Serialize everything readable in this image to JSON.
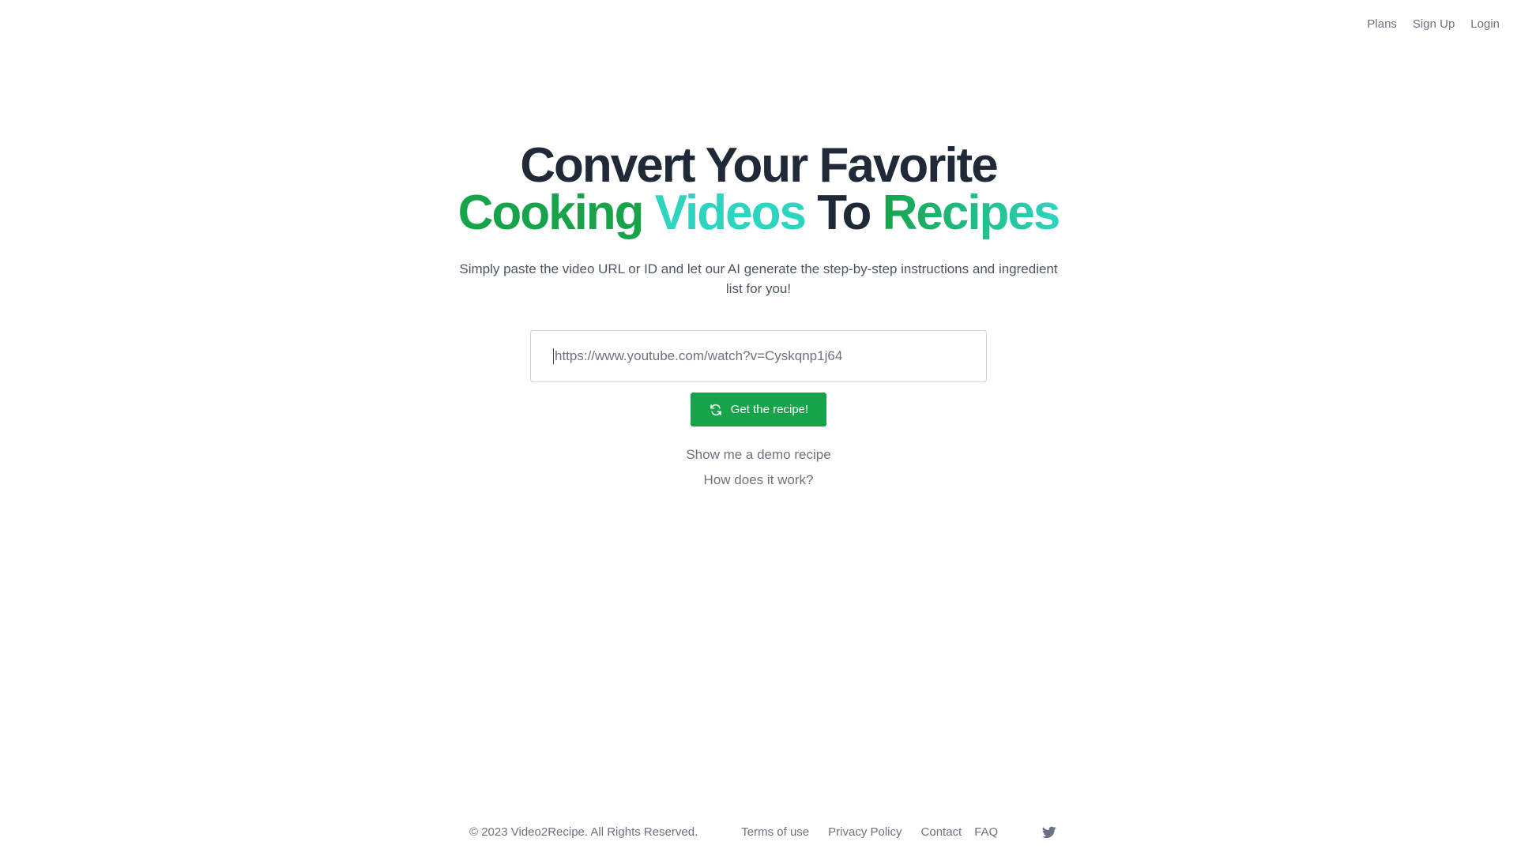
{
  "nav": {
    "plans": "Plans",
    "signup": "Sign Up",
    "login": "Login"
  },
  "hero": {
    "line1": "Convert Your Favorite",
    "word_cooking": "Cooking",
    "word_videos": "Videos",
    "word_to": "To",
    "word_recipes": "Recipes",
    "subtitle": "Simply paste the video URL or ID and let our AI generate the step-by-step instructions and ingredient list for you!",
    "input_placeholder": "https://www.youtube.com/watch?v=Cyskqnp1j64",
    "cta_label": "Get the recipe!",
    "cta_icon": "refresh-icon",
    "demo_link": "Show me a demo recipe",
    "how_link": "How does it work?"
  },
  "footer": {
    "copyright": "© 2023 Video2Recipe. All Rights Reserved.",
    "terms": "Terms of use",
    "privacy": "Privacy Policy",
    "contact": "Contact",
    "faq": "FAQ",
    "social_icon": "twitter-icon"
  },
  "colors": {
    "accent": "#16a34a",
    "accent_teal": "#2dd4bf",
    "heading": "#1f2937",
    "muted": "#6b7280"
  }
}
